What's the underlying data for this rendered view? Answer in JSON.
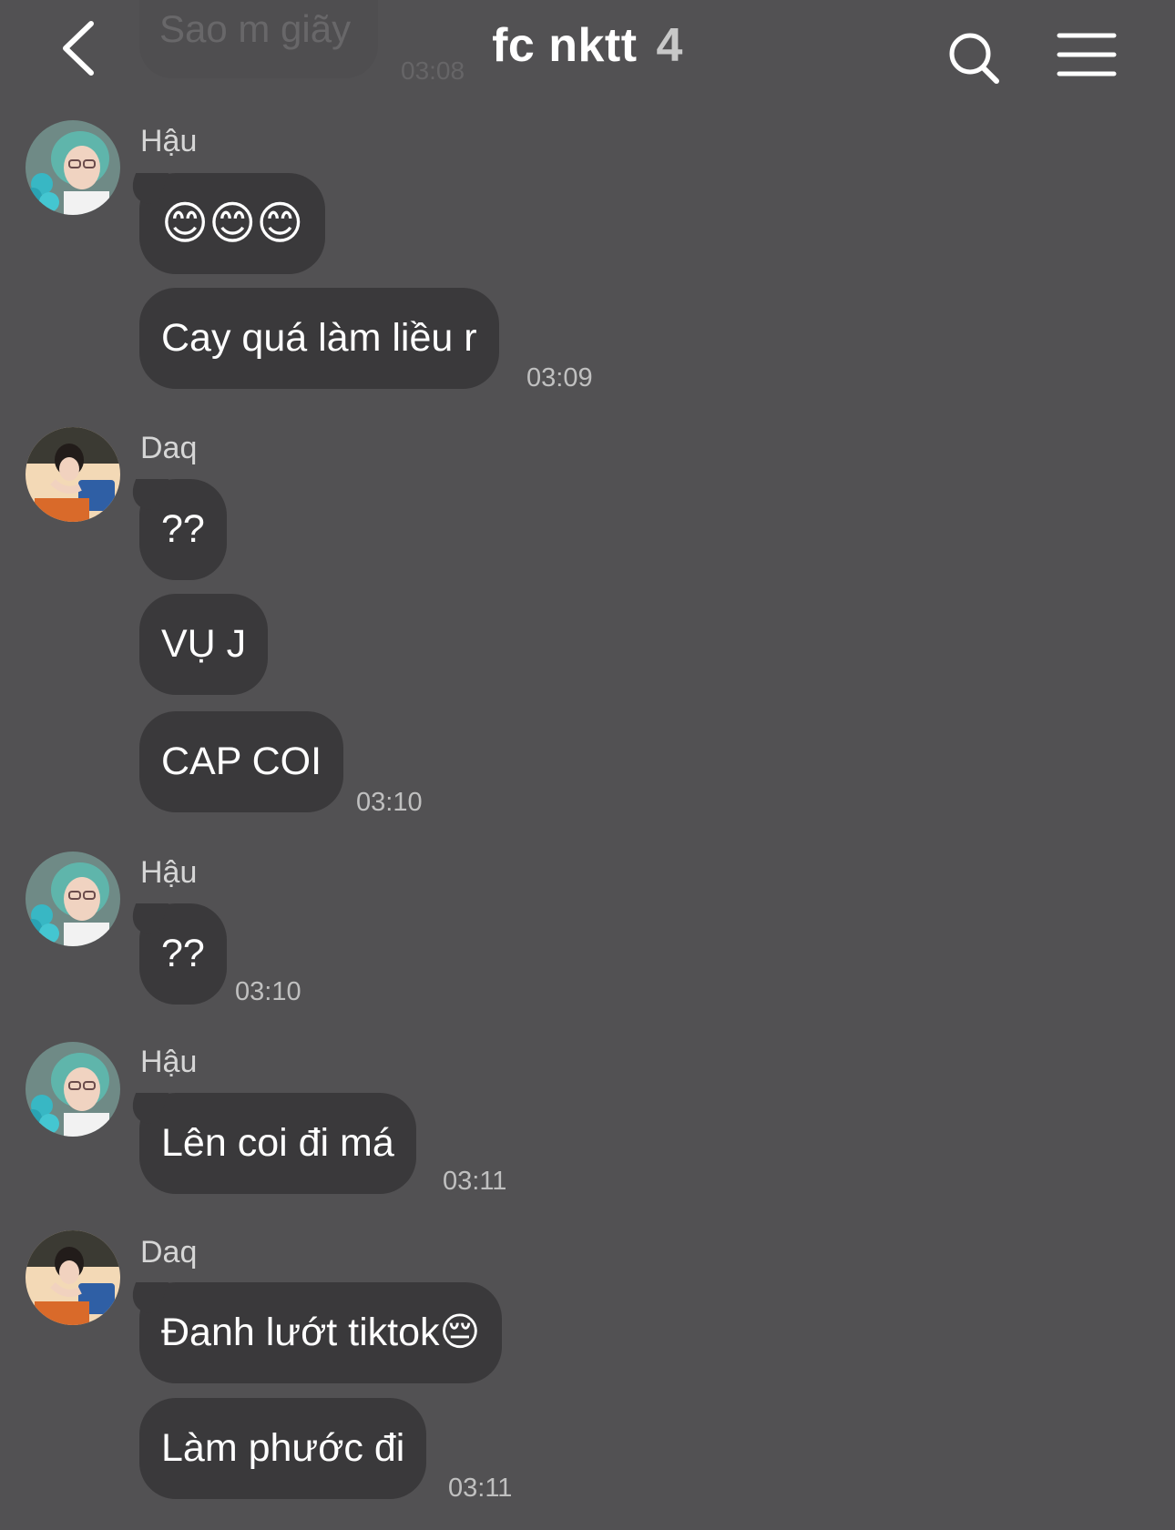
{
  "header": {
    "title": "fc nktt",
    "count": "4"
  },
  "previous_message": {
    "text": "Sao m giãy",
    "time": "03:08"
  },
  "messages": [
    {
      "sender": "Hậu",
      "bubbles": [
        "😊😊😊",
        "Cay quá làm liều r"
      ],
      "time": "03:09"
    },
    {
      "sender": "Daq",
      "bubbles": [
        "??",
        "VỤ J",
        "CAP COI"
      ],
      "time": "03:10"
    },
    {
      "sender": "Hậu",
      "bubbles": [
        "??"
      ],
      "time": "03:10"
    },
    {
      "sender": "Hậu",
      "bubbles": [
        "Lên coi đi má"
      ],
      "time": "03:11"
    },
    {
      "sender": "Daq",
      "bubbles": [
        "Đanh lướt tiktok😔",
        "Làm phước đi"
      ],
      "time": "03:11"
    }
  ],
  "colors": {
    "background": "#525153",
    "bubble": "#3a393b",
    "text": "#ffffff",
    "meta": "#c0c0c0"
  },
  "icons": {
    "back": "chevron-left-icon",
    "search": "search-icon",
    "menu": "hamburger-menu-icon"
  }
}
